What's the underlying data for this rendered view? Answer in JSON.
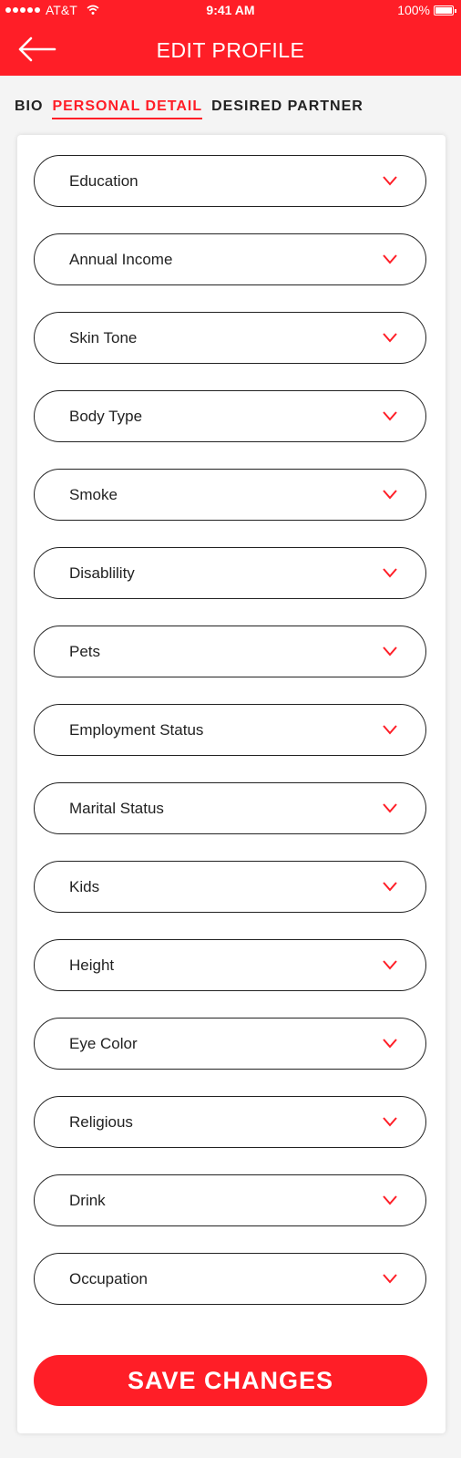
{
  "status_bar": {
    "carrier": "AT&T",
    "time": "9:41 AM",
    "battery": "100%"
  },
  "header": {
    "title": "EDIT PROFILE"
  },
  "tabs": [
    {
      "label": "BIO"
    },
    {
      "label": "PERSONAL DETAIL"
    },
    {
      "label": "DESIRED PARTNER"
    }
  ],
  "fields": [
    {
      "label": "Education"
    },
    {
      "label": "Annual Income"
    },
    {
      "label": "Skin Tone"
    },
    {
      "label": "Body Type"
    },
    {
      "label": "Smoke"
    },
    {
      "label": "Disablility"
    },
    {
      "label": "Pets"
    },
    {
      "label": "Employment Status"
    },
    {
      "label": "Marital Status"
    },
    {
      "label": "Kids"
    },
    {
      "label": "Height"
    },
    {
      "label": "Eye Color"
    },
    {
      "label": "Religious"
    },
    {
      "label": "Drink"
    },
    {
      "label": "Occupation"
    }
  ],
  "save_label": "SAVE CHANGES",
  "colors": {
    "accent": "#ff1e27",
    "text": "#222222",
    "background": "#f4f4f4"
  }
}
